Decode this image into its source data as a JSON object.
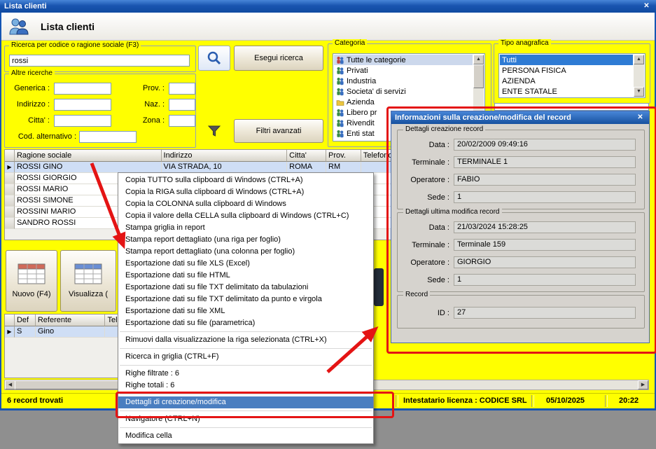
{
  "icons": {
    "marker": "▶",
    "up": "▲",
    "down": "▼",
    "left": "◀",
    "right": "▶",
    "close": "✕"
  },
  "window": {
    "title": "Lista clienti"
  },
  "header": {
    "title": "Lista clienti"
  },
  "search": {
    "group": "Ricerca per codice o ragione sociale (F3)",
    "value": "rossi",
    "execute": "Esegui ricerca",
    "filters": "Filtri avanzati"
  },
  "altre": {
    "group": "Altre ricerche",
    "rows": [
      {
        "label": "Generica :",
        "value": "",
        "right_label": "Prov. :",
        "right_value": ""
      },
      {
        "label": "Indirizzo :",
        "value": "",
        "right_label": "Naz. :",
        "right_value": ""
      },
      {
        "label": "Citta' :",
        "value": "",
        "right_label": "Zona :",
        "right_value": ""
      },
      {
        "label": "Cod. alternativo :",
        "value": ""
      }
    ]
  },
  "categoria": {
    "group": "Categoria",
    "items": [
      {
        "label": "Tutte le categorie",
        "icon": "users-red",
        "selected": true
      },
      {
        "label": "Privati",
        "icon": "users"
      },
      {
        "label": "Industria",
        "icon": "users"
      },
      {
        "label": "Societa' di servizi",
        "icon": "users"
      },
      {
        "label": "Azienda",
        "icon": "folder"
      },
      {
        "label": "Libero pr",
        "icon": "users"
      },
      {
        "label": "Rivendit",
        "icon": "users"
      },
      {
        "label": "Enti stat",
        "icon": "users"
      }
    ]
  },
  "tipo": {
    "group": "Tipo anagrafica",
    "items": [
      {
        "label": "Tutti",
        "selected": true
      },
      {
        "label": "PERSONA FISICA"
      },
      {
        "label": "AZIENDA"
      },
      {
        "label": "ENTE STATALE"
      }
    ]
  },
  "grid": {
    "columns": [
      "",
      "Ragione sociale",
      "Indirizzo",
      "Citta'",
      "Prov.",
      "Telefono"
    ],
    "rows": [
      {
        "cells": [
          "ROSSI GINO",
          "VIA STRADA, 10",
          "ROMA",
          "RM",
          ""
        ],
        "selected": true
      },
      {
        "cells": [
          "ROSSI GIORGIO",
          "",
          "",
          "",
          ""
        ]
      },
      {
        "cells": [
          "ROSSI MARIO",
          "",
          "",
          "",
          ""
        ]
      },
      {
        "cells": [
          "ROSSI SIMONE",
          "",
          "",
          "",
          ""
        ]
      },
      {
        "cells": [
          "ROSSINI MARIO",
          "",
          "",
          "",
          ""
        ]
      },
      {
        "cells": [
          "SANDRO ROSSI",
          "",
          "",
          "",
          ""
        ]
      }
    ]
  },
  "buttons": {
    "nuovo": "Nuovo (F4)",
    "visualizza": "Visualizza ("
  },
  "grid2": {
    "columns": [
      "",
      "Def",
      "Referente",
      "Tele"
    ],
    "rows": [
      {
        "cells": [
          "S",
          "Gino",
          ""
        ],
        "selected": true
      }
    ]
  },
  "statusbar": {
    "records": "6 record trovati",
    "license": "Intestatario licenza : CODICE SRL",
    "date": "05/10/2025",
    "time": "20:22"
  },
  "menu": {
    "items": [
      {
        "label": "Copia TUTTO sulla clipboard di Windows (CTRL+A)"
      },
      {
        "label": "Copia la RIGA sulla clipboard di Windows (CTRL+A)"
      },
      {
        "label": "Copia la COLONNA sulla clipboard di Windows"
      },
      {
        "label": "Copia il valore della CELLA sulla clipboard di Windows (CTRL+C)"
      },
      {
        "label": "Stampa griglia in report"
      },
      {
        "label": "Stampa report dettagliato (una riga per foglio)"
      },
      {
        "label": "Stampa report dettagliato (una colonna per foglio)"
      },
      {
        "label": "Esportazione dati su file XLS (Excel)"
      },
      {
        "label": "Esportazione dati su file HTML"
      },
      {
        "label": "Esportazione dati su file TXT delimitato da tabulazioni"
      },
      {
        "label": "Esportazione dati su file TXT delimitato da punto e virgola"
      },
      {
        "label": "Esportazione dati su file XML"
      },
      {
        "label": "Esportazione dati su file (parametrica)"
      },
      {
        "sep": true
      },
      {
        "label": "Rimuovi dalla visualizzazione la riga selezionata (CTRL+X)"
      },
      {
        "sep": true
      },
      {
        "label": "Ricerca in griglia (CTRL+F)"
      },
      {
        "sep": true
      },
      {
        "label": "Righe filtrate : 6"
      },
      {
        "label": "Righe totali : 6"
      },
      {
        "sep": true
      },
      {
        "label": "Dettagli di creazione/modifica",
        "highlighted": true
      },
      {
        "sep": true
      },
      {
        "label": "Navigatore (CTRL+N)"
      },
      {
        "sep": true
      },
      {
        "label": "Modifica cella"
      }
    ]
  },
  "dialog": {
    "title": "Informazioni sulla creazione/modifica del record",
    "groups": [
      {
        "label": "Dettagli creazione record",
        "fields": [
          {
            "label": "Data :",
            "value": "20/02/2009 09:49:16"
          },
          {
            "label": "Terminale :",
            "value": "TERMINALE 1"
          },
          {
            "label": "Operatore :",
            "value": "FABIO"
          },
          {
            "label": "Sede :",
            "value": "1"
          }
        ]
      },
      {
        "label": "Dettagli ultima modifica record",
        "fields": [
          {
            "label": "Data :",
            "value": "21/03/2024 15:28:25"
          },
          {
            "label": "Terminale :",
            "value": "Terminale 159"
          },
          {
            "label": "Operatore :",
            "value": "GIORGIO"
          },
          {
            "label": "Sede :",
            "value": "1"
          }
        ]
      },
      {
        "label": "Record",
        "fields": [
          {
            "label": "ID :",
            "value": "27"
          }
        ]
      }
    ]
  },
  "colors": {
    "accent_red": "#e41414",
    "selection_blue": "#2e7bd4",
    "yellow": "#ffff00"
  }
}
